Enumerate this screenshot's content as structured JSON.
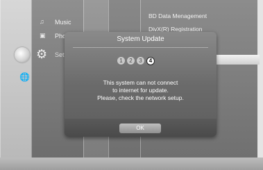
{
  "menu": {
    "music_label": "Music",
    "photo_label": "Pho",
    "setup_label": "Set",
    "top_items": [
      "BD Data Menagement",
      "DivX(R) Registration"
    ]
  },
  "dialog": {
    "title": "System Update",
    "steps": [
      "1",
      "2",
      "3",
      "4"
    ],
    "active_step": 4,
    "message_lines": [
      "This system can not connect",
      "to internet for update.",
      "Please, check the network setup."
    ],
    "ok_label": "OK"
  }
}
